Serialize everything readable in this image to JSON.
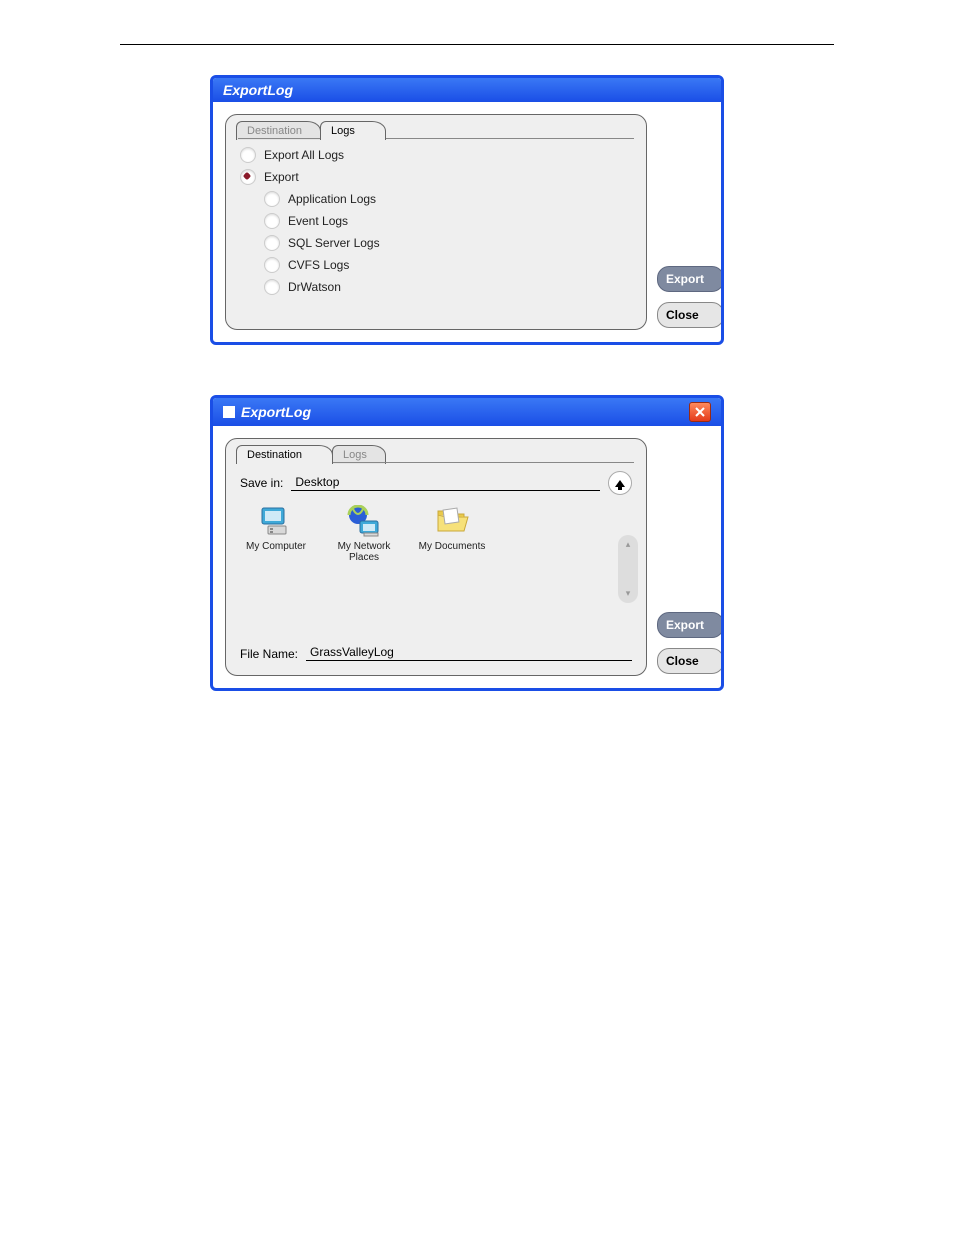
{
  "dialog1": {
    "title": "ExportLog",
    "tabs": {
      "destination": "Destination",
      "logs": "Logs",
      "active": "logs"
    },
    "options": {
      "export_all": "Export All Logs",
      "export": "Export",
      "subs": {
        "application": "Application Logs",
        "event": "Event Logs",
        "sql": "SQL Server Logs",
        "cvfs": "CVFS Logs",
        "drwatson": "DrWatson"
      }
    },
    "buttons": {
      "export": "Export",
      "close": "Close"
    }
  },
  "dialog2": {
    "title": "ExportLog",
    "tabs": {
      "destination": "Destination",
      "logs": "Logs",
      "active": "destination"
    },
    "savein_label": "Save in:",
    "savein_value": "Desktop",
    "items": {
      "my_computer": "My Computer",
      "my_network": "My Network Places",
      "my_documents": "My Documents"
    },
    "filename_label": "File Name:",
    "filename_value": "GrassValleyLog",
    "buttons": {
      "export": "Export",
      "close": "Close"
    }
  }
}
